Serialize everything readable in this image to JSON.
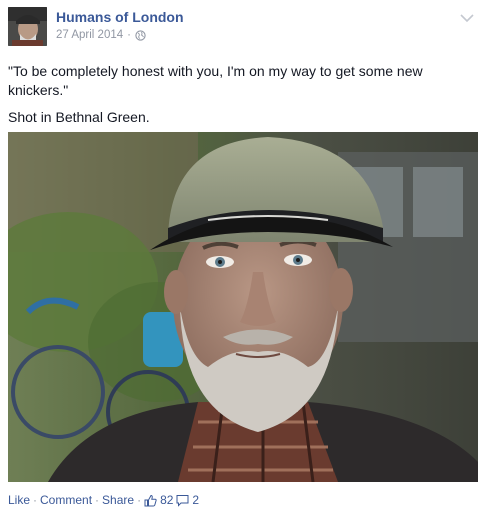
{
  "post": {
    "page_name": "Humans of London",
    "date": "27 April 2014",
    "separator": "·",
    "caption_quote": "\"To be completely honest with you, I'm on my way to get some new knickers.\"",
    "caption_location": "Shot in Bethnal Green.",
    "privacy_icon": "globe-icon",
    "menu_icon": "chevron-down-icon"
  },
  "footer": {
    "like_label": "Like",
    "comment_label": "Comment",
    "share_label": "Share",
    "separator": "·",
    "like_count": "82",
    "comment_count": "2",
    "like_icon": "thumbs-up-icon",
    "comment_icon": "comment-bubble-icon"
  },
  "colors": {
    "link": "#3b5998",
    "meta": "#9197a3",
    "text": "#141823"
  }
}
